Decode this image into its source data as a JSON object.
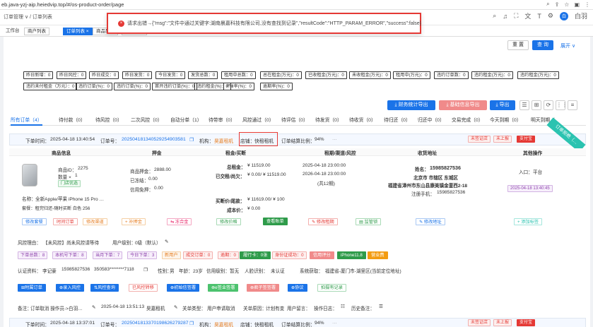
{
  "browser": {
    "url": "eb.java-yzj-aip.heiedvip.top/#/os-product-order/page"
  },
  "topbar": {
    "breadcrumb": "订单管理 ∨ / 订单列表",
    "user_name": "白羽",
    "avatar_text": "白"
  },
  "tabs": [
    {
      "label": "工作台"
    },
    {
      "label": "商户列表"
    },
    {
      "label": "订单列表 ×"
    },
    {
      "label": "商品列表"
    },
    {
      "label": "机构管理"
    }
  ],
  "error_popup": {
    "icon": "×",
    "text": "请求出错→{\"msg\":\"文件中通过关键字:湖南晨嘉科技有限公司,没有查找到记录\",\"resultCode\":\"HTTP_PARAM_ERROR\",\"success\":false}"
  },
  "search": {
    "reset_label": "重 置",
    "search_label": "查 询",
    "expand_label": "展开 ∨"
  },
  "stats_row1": [
    {
      "label": "昨日新增：0",
      "color": "c-red"
    },
    {
      "label": "昨日风控：0",
      "color": "c-orange"
    },
    {
      "label": "昨日成交：0",
      "color": "c-orange"
    },
    {
      "label": "昨日发货：0",
      "color": "c-green"
    },
    {
      "label": "今日发货：0",
      "color": "c-blue"
    },
    {
      "label": "发货总数：0",
      "color": "c-blue"
    },
    {
      "label": "租用中总数：0",
      "color": "c-red"
    },
    {
      "label": "总在租金(万元)：0",
      "color": "c-orange"
    },
    {
      "label": "已收租金(万元)：0",
      "color": "c-green"
    },
    {
      "label": "未收租金(万元)：0",
      "color": "c-green"
    },
    {
      "label": "租用中(万元)：0",
      "color": "c-blue"
    },
    {
      "label": "违约订单数：0",
      "color": "c-purple"
    },
    {
      "label": "违约租金(万元)：0",
      "color": "c-purple"
    },
    {
      "label": "违约租金(万元)：0",
      "color": "c-purple"
    }
  ],
  "stats_row2": [
    {
      "label": "违约未付租金（万元）：0",
      "color": "c-red"
    },
    {
      "label": "违约订单(%)：0",
      "color": "c-red"
    },
    {
      "label": "违约订单(%)：0",
      "color": "c-orange"
    },
    {
      "label": "首开违约订单(%)：0",
      "color": "c-orange"
    },
    {
      "label": "违约租金(%)：0",
      "color": "c-green"
    },
    {
      "label": "坏Ⅲ率(%)：0",
      "color": "c-blue"
    },
    {
      "label": "逾期率(%)：0",
      "color": "c-purple"
    }
  ],
  "actions": {
    "finance_export": "⤓ 财务统计导出",
    "basic_export": "⤓ 基础信息导出",
    "export": "⤓ 导出"
  },
  "tool_icons": [
    "☰",
    "⊞",
    "⟳",
    "⋮⋮",
    "≡"
  ],
  "status_tabs": [
    {
      "label": "所有订单（4）",
      "active": true
    },
    {
      "label": "待付款（0）"
    },
    {
      "label": "待风控（0）"
    },
    {
      "label": "二次风控（0）"
    },
    {
      "label": "自动分单（1）"
    },
    {
      "label": "待带审（0）"
    },
    {
      "label": "风控通过（0）"
    },
    {
      "label": "待评估（0）"
    },
    {
      "label": "待发货（0）"
    },
    {
      "label": "待收货（0）"
    },
    {
      "label": "待归还（0）"
    },
    {
      "label": "归还中（0）"
    },
    {
      "label": "交易完成（0）"
    },
    {
      "label": "今天到期（0）"
    },
    {
      "label": "明天到期（"
    }
  ],
  "order1": {
    "time_label": "下单时间：",
    "time": "2025-04-18 13:40:54",
    "order_no_label": "订单号：",
    "order_no": "20250418134052925490358​1",
    "org_label": "机构：",
    "org": "昊嘉租机",
    "store_label": "店铺：",
    "store": "快租租机",
    "ratio_label": "订单结算比例：",
    "ratio": "94%",
    "more": "···",
    "tags": [
      "未签证店",
      "未上报",
      "支付宝"
    ],
    "ribbon": "订单拒绝（…",
    "columns": [
      "商品信息",
      "押金",
      "租金/买断",
      "租期/渠道/风控",
      "收货地址",
      "其他操作"
    ],
    "product": {
      "id_label": "商品ID：",
      "id": "2275",
      "qty_label": "数量 × ",
      "qty": "1",
      "store_tag": "门店优选",
      "name_label": "名称：",
      "name": "全新Apple/苹果 iPhone 15 Pro …",
      "package": "套餐：租完归还-随时买断 白色 256"
    },
    "deposit": {
      "item_label": "商品押金：",
      "item": "2888.00",
      "freeze_label": "已冻结：",
      "freeze": "0.00",
      "credit_label": "信用免押：",
      "credit": "0.00"
    },
    "rent": {
      "total_label": "总租金：",
      "total": "¥ 11519.00",
      "paid_label": "已交租/尚欠：",
      "paid": "¥ 0.00/ ¥ 11519.00",
      "buyout_label": "买断价/尾款：",
      "buyout": "¥ 11619.00/ ¥ 100",
      "cost_label": "成本价：",
      "cost": "¥ 0.00"
    },
    "period": {
      "start": "2025-04-18 23:00:00",
      "end": "2026-04-18 23:00:00",
      "terms": "(共12期)"
    },
    "address": {
      "name_label": "姓名：",
      "name": "15985827536",
      "region": "北京市 市辖区 东城区",
      "detail": "福建省漳州市东山县康美镇金銮西2-18",
      "phone_label": "注册手机：",
      "phone": "15985827536"
    },
    "other": {
      "entry_label": "入口：",
      "entry": "平台",
      "time": "2025-04-18 13:40:45"
    },
    "buttons": {
      "edit_package": "修改套餐",
      "remarks": "时间订单",
      "edit_channel": "修改渠道",
      "add_deposit": "+ 补押金",
      "freeze": "⇆ 冻合金",
      "edit_price": "修改价格",
      "view_account": "查看账单",
      "edit_period": "✎ 修改租期",
      "monitor": "▤ 监管锁",
      "edit_address": "✎ 修改地址",
      "add_tag": "+ 添加标签"
    },
    "risk": {
      "label": "风控理由：",
      "value": "【未风控】尚未风控请等待",
      "level_label": "用户级别：",
      "level": "0级（默认）",
      "edit": "✎"
    },
    "risk_chips": [
      {
        "label": "下单总数：8",
        "color": "c-purple"
      },
      {
        "label": "本机号下单：8",
        "color": "c-purple"
      },
      {
        "label": "当月下单：7",
        "color": "c-purple"
      },
      {
        "label": "今日下单：3",
        "color": "c-purple"
      },
      {
        "label": "新用户",
        "color": "c-orange"
      },
      {
        "label": "成交订单：0",
        "color": "c-red"
      },
      {
        "label": "逾期：0",
        "color": "c-red"
      },
      {
        "label": "履行卡：0张",
        "color": "s-green"
      },
      {
        "label": "身份证成功：0",
        "color": "c-red"
      },
      {
        "label": "信用评分",
        "color": "s-lred"
      },
      {
        "label": "iPhone11.8",
        "color": "s-green"
      },
      {
        "label": "营业费",
        "color": "s-orange"
      }
    ],
    "auth": {
      "label": "认证资料：",
      "name": "李记豪",
      "phone": "15985827536",
      "id": "350583********7118",
      "gender_label": "性别：",
      "gender": "男",
      "age_label": "年龄：",
      "age": "23岁",
      "credit_label": "信用级别：",
      "credit": "暂无",
      "face_label": "人脸识别：",
      "face": "未认证",
      "system_label": "系统获取：",
      "system": "福建省-厦门市-湖里区(当前定位地址)"
    },
    "bottom_buttons": [
      {
        "label": "⊞附属订单",
        "color": "s-blue"
      },
      {
        "label": "⊕录入风控",
        "color": "s-blue"
      },
      {
        "label": "⇅风控查询",
        "color": "s-blue"
      },
      {
        "label": "已风控转移",
        "color": "s-red-o"
      },
      {
        "label": "⊕初始信签署",
        "color": "s-blue"
      },
      {
        "label": "⊗e签业签署",
        "color": "s-lgreen"
      },
      {
        "label": "⊗君子签签署",
        "color": "s-lred"
      },
      {
        "label": "⊕协议",
        "color": "s-blue"
      },
      {
        "label": "拍摄有记录",
        "color": "s-green-o"
      }
    ],
    "note": {
      "label": "备注：",
      "value": "订单取消 操作员->白羽…",
      "op_time": "2025-04-18 13:51:13",
      "op_org": "昊嘉租机",
      "edit": "✎",
      "related_label": "关单类型：",
      "related": "用户申请取消",
      "reason_label": "关单原因：",
      "reason": "计划有变",
      "user_msg_label": "用户留言：",
      "op_log_label": "操作日志：",
      "history_label": "历史备注："
    }
  },
  "order2": {
    "time_label": "下单时间：",
    "time": "2025-04-18 13:37:01",
    "order_no_label": "订单号：",
    "order_no": "2025041813370198626279287",
    "org_label": "机构：",
    "org": "昊嘉租机",
    "store_label": "店铺：",
    "store": "快租租机",
    "ratio_label": "订单结算比例：",
    "ratio": "94%",
    "more": "···",
    "tags": [
      "未签证店",
      "未上报",
      "支付宝"
    ]
  }
}
